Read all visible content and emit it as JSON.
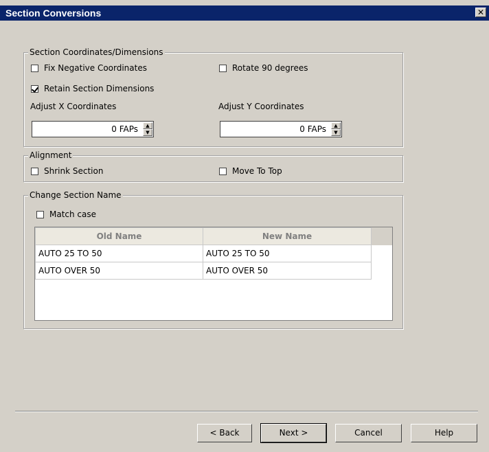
{
  "window": {
    "title": "Section Conversions",
    "close_glyph": "✕"
  },
  "coords_group": {
    "legend": "Section Coordinates/Dimensions",
    "fix_negative": {
      "label": "Fix Negative Coordinates",
      "checked": false
    },
    "rotate_90": {
      "label": "Rotate 90 degrees",
      "checked": false
    },
    "retain_dims": {
      "label": "Retain Section Dimensions",
      "checked": true
    },
    "adjust_x_label": "Adjust X Coordinates",
    "adjust_y_label": "Adjust Y Coordinates",
    "adjust_x_value": "0 FAPs",
    "adjust_y_value": "0 FAPs"
  },
  "alignment_group": {
    "legend": "Alignment",
    "shrink": {
      "label": "Shrink Section",
      "checked": false
    },
    "move_top": {
      "label": "Move To Top",
      "checked": false
    }
  },
  "name_group": {
    "legend": "Change Section Name",
    "match_case": {
      "label": "Match case",
      "checked": false
    },
    "columns": [
      "Old Name",
      "New Name"
    ],
    "rows": [
      [
        "AUTO 25 TO 50",
        "AUTO 25 TO 50"
      ],
      [
        "AUTO OVER 50",
        "AUTO OVER 50"
      ]
    ]
  },
  "buttons": {
    "back": "< Back",
    "next": "Next >",
    "cancel": "Cancel",
    "help": "Help"
  }
}
